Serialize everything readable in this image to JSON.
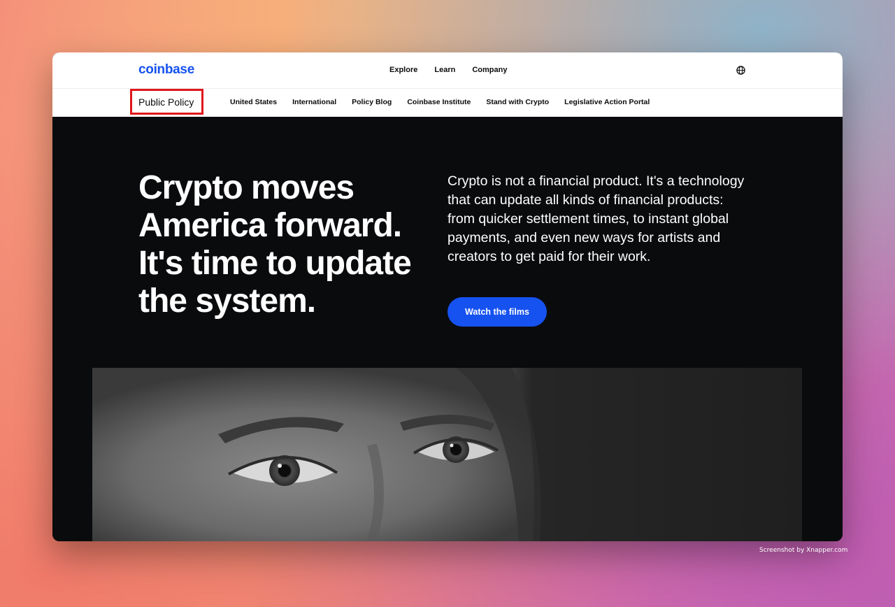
{
  "header": {
    "logo": "coinbase",
    "nav": [
      "Explore",
      "Learn",
      "Company"
    ],
    "language_icon": "globe-icon"
  },
  "subnav": {
    "title": "Public Policy",
    "links": [
      "United States",
      "International",
      "Policy Blog",
      "Coinbase Institute",
      "Stand with Crypto",
      "Legislative Action Portal"
    ]
  },
  "hero": {
    "headline": "Crypto moves America forward. It's time to update the system.",
    "subtext": "Crypto is not a financial product. It's a technology that can update all kinds of financial products: from quicker settlement times, to instant global payments, and even new ways for artists and creators to get paid for their work.",
    "cta_label": "Watch the films"
  },
  "colors": {
    "brand": "#1652f0",
    "highlight_box": "#e0161b",
    "hero_bg": "#0a0b0d"
  },
  "credit": "Screenshot by Xnapper.com"
}
